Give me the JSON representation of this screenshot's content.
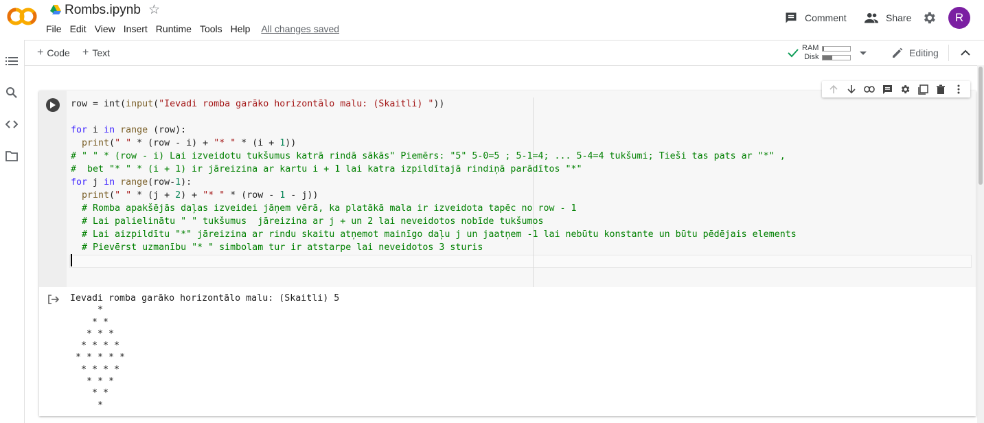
{
  "app": {
    "doc_title": "Rombs.ipynb",
    "logo_text": "CO"
  },
  "menu": {
    "items": [
      "File",
      "Edit",
      "View",
      "Insert",
      "Runtime",
      "Tools",
      "Help"
    ],
    "save_status": "All changes saved"
  },
  "header": {
    "comment_label": "Comment",
    "share_label": "Share",
    "avatar_initial": "R"
  },
  "toolbar": {
    "add_code_label": "Code",
    "add_text_label": "Text",
    "ram_label": "RAM",
    "disk_label": "Disk",
    "ram_usage_fraction": 0.05,
    "disk_usage_fraction": 0.35,
    "editing_label": "Editing"
  },
  "colors": {
    "accent": "#7b1fa2",
    "connected": "#0f9d58",
    "comment_green": "#008000",
    "keyword": "#3f25ff"
  },
  "cell": {
    "code_lines": [
      "row = int(input(\"Ievadi romba garāko horizontālo malu: (Skaitli) \"))",
      "",
      "for i in range (row):",
      "  print(\" \" * (row - i) + \"* \" * (i + 1))",
      "# \" \" * (row - i) Lai izveidotu tukšumus katrā rindā sākās\" Piemērs: \"5\" 5-0=5 ; 5-1=4; ... 5-4=4 tukšumi; Tieši tas pats ar \"*\" ,",
      "#  bet \"* \" * (i + 1) ir jāreizina ar kartu i + 1 lai katra izpildītajā rindiņā parādītos \"*\"",
      "for j in range(row-1):",
      "  print(\" \" * (j + 2) + \"* \" * (row - 1 - j))",
      "  # Romba apakšējās daļas izveidei jāņem vērā, ka platākā mala ir izveidota tapēc no row - 1",
      "  # Lai palielinātu \" \" tukšumus  jāreizina ar j + un 2 lai neveidotos nobīde tukšumos",
      "  # Lai aizpildītu \"*\" jāreizina ar rindu skaitu atņemot mainīgo daļu j un jaatņem -1 lai nebūtu konstante un būtu pēdējais elements",
      "  # Pievērst uzmanību \"* \" simbolam tur ir atstarpe lai neveidotos 3 sturis"
    ],
    "output_lines": [
      "Ievadi romba garāko horizontālo malu: (Skaitli) 5",
      "     *",
      "    * *",
      "   * * *",
      "  * * * *",
      " * * * * *",
      "  * * * *",
      "   * * *",
      "    * *",
      "     *"
    ]
  }
}
